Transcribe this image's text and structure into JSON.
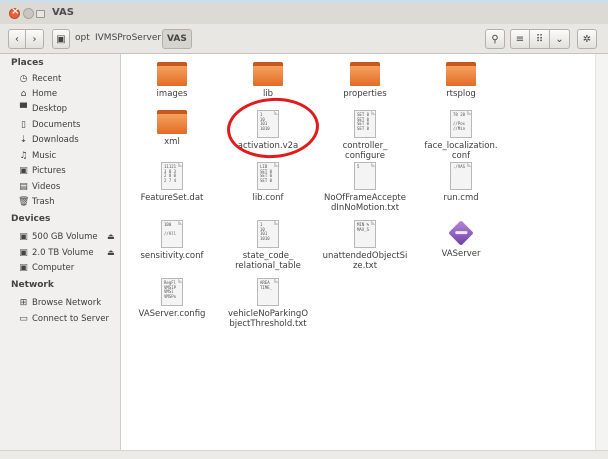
{
  "window": {
    "title": "VAS"
  },
  "toolbar": {
    "back": "‹",
    "forward": "›",
    "disk_icon": "▣",
    "breadcrumbs": [
      "opt",
      "IVMSProServer",
      "VAS"
    ],
    "search_icon": "⚲",
    "list_icon": "≡",
    "grid_icon": "⠿",
    "menu_icon": "⌄",
    "gear_icon": "✲"
  },
  "sidebar": {
    "places_header": "Places",
    "places": [
      {
        "label": "Recent",
        "icon": "◷"
      },
      {
        "label": "Home",
        "icon": "⌂"
      },
      {
        "label": "Desktop",
        "icon": "▀"
      },
      {
        "label": "Documents",
        "icon": "▯"
      },
      {
        "label": "Downloads",
        "icon": "⇣"
      },
      {
        "label": "Music",
        "icon": "♫"
      },
      {
        "label": "Pictures",
        "icon": "▣"
      },
      {
        "label": "Videos",
        "icon": "▤"
      },
      {
        "label": "Trash",
        "icon": "🗑"
      }
    ],
    "devices_header": "Devices",
    "devices": [
      {
        "label": "500 GB Volume",
        "icon": "▣",
        "eject": "⏏"
      },
      {
        "label": "2.0 TB Volume",
        "icon": "▣",
        "eject": "⏏"
      },
      {
        "label": "Computer",
        "icon": "▣"
      }
    ],
    "network_header": "Network",
    "network": [
      {
        "label": "Browse Network",
        "icon": "⊞"
      },
      {
        "label": "Connect to Server",
        "icon": "▭"
      }
    ]
  },
  "files": [
    {
      "name": "images",
      "kind": "folder"
    },
    {
      "name": "lib",
      "kind": "folder"
    },
    {
      "name": "properties",
      "kind": "folder"
    },
    {
      "name": "rtsplog",
      "kind": "folder"
    },
    {
      "name": "xml",
      "kind": "folder"
    },
    {
      "name": "activation.v2a",
      "kind": "doc",
      "preview": "1\n10\n101\n1010"
    },
    {
      "name": "controller_\nconfigure",
      "kind": "doc",
      "preview": "SET 0\nSET 0\nSET 0\nSET 0"
    },
    {
      "name": "face_localization.\nconf",
      "kind": "doc",
      "preview": "78 20\n\n//Pos\n//Min"
    },
    {
      "name": "FeatureSet.dat",
      "kind": "doc",
      "preview": "11121\n3 0 3\n2 0 0\n2 7 4"
    },
    {
      "name": "lib.conf",
      "kind": "doc",
      "preview": "LIB\nSET 0\nSET 0\nSET 0"
    },
    {
      "name": "NoOfFrameAccepte\ndInNoMotion.txt",
      "kind": "doc",
      "preview": "5"
    },
    {
      "name": "run.cmd",
      "kind": "doc",
      "preview": "./VAS"
    },
    {
      "name": "sensitivity.conf",
      "kind": "doc",
      "preview": "100\n\n//All"
    },
    {
      "name": "state_code_\nrelational_table",
      "kind": "doc",
      "preview": "1\n10\n101\n1010"
    },
    {
      "name": "unattendedObjectSi\nze.txt",
      "kind": "doc",
      "preview": "MIN %\nMAX_S"
    },
    {
      "name": "VAServer",
      "kind": "app"
    },
    {
      "name": "VAServer.config",
      "kind": "doc",
      "preview": "RegFl\nVMSIP\nVMSi\nVMSPo"
    },
    {
      "name": "vehicleNoParkingO\nbjectThreshold.txt",
      "kind": "doc",
      "preview": "AREA\nTIME_"
    }
  ]
}
